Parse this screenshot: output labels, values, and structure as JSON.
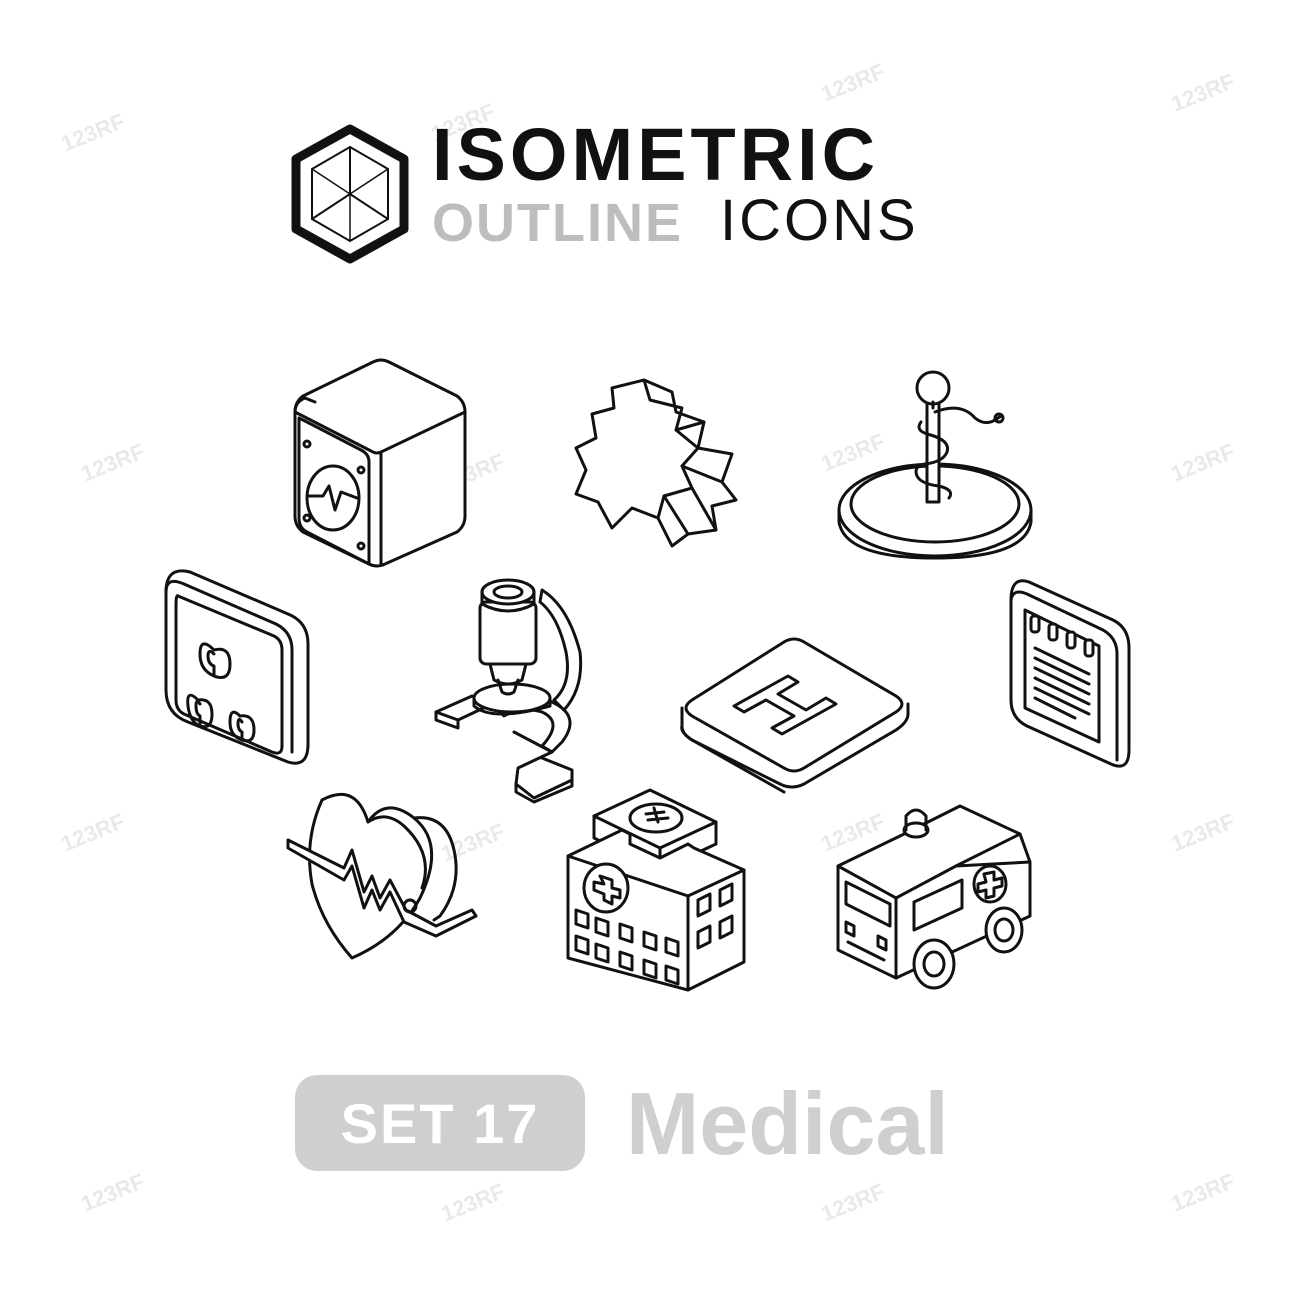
{
  "header": {
    "title_line1": "ISOMETRIC",
    "title_line2_bold": "OUTLINE",
    "title_line2_light": "ICONS"
  },
  "footer": {
    "set_label": "SET 17",
    "category": "Medical"
  },
  "watermark": {
    "text": "123RF"
  },
  "icons": [
    "cardiogram-monitor-icon",
    "star-of-life-cross-icon",
    "rod-of-asclepius-icon",
    "pills-tile-icon",
    "microscope-icon",
    "helipad-icon",
    "notepad-tile-icon",
    "heart-pulse-icon",
    "hospital-building-icon",
    "ambulance-icon"
  ],
  "colors": {
    "stroke": "#111111",
    "gray_text": "#cfcfcf",
    "background": "#ffffff"
  }
}
